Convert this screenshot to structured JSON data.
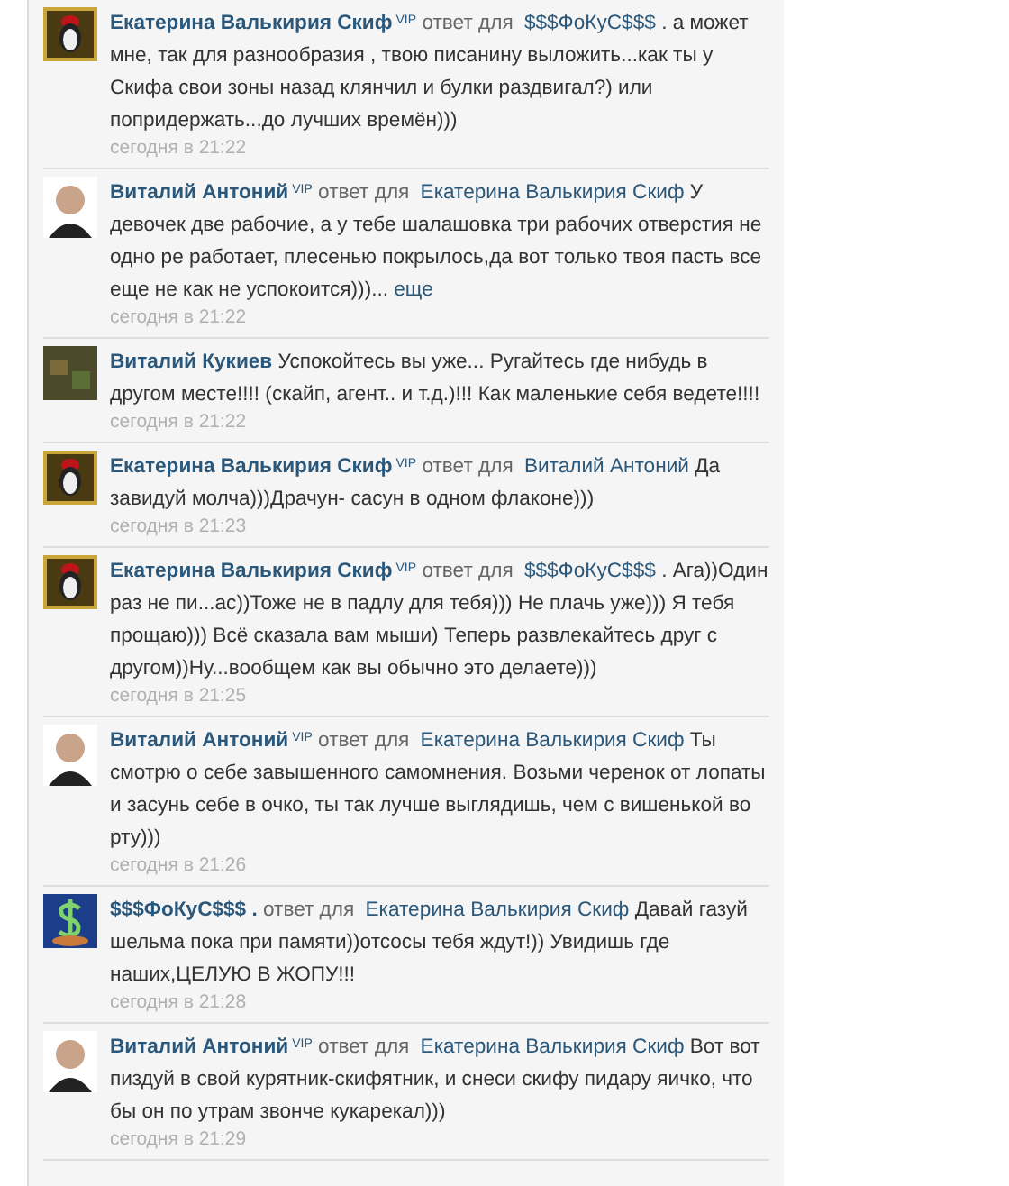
{
  "comments": [
    {
      "kind": "penguin",
      "author": "Екатерина Валькирия Скиф",
      "badge": "VIP",
      "reply_label": "ответ для",
      "reply_to": "$$$ФоКуС$$$",
      "text": ". а может мне, так для разнообразия , твою писанину выложить...как ты у Скифа свои зоны назад клянчил и булки раздвигал?) или попридержать...до лучших времён)))",
      "time": "сегодня в 21:22"
    },
    {
      "kind": "portrait",
      "author": "Виталий Антоний",
      "badge": "VIP",
      "reply_label": "ответ для",
      "reply_to": "Екатерина Валькирия Скиф",
      "text": "У девочек две рабочие, а у тебе шалашовка три рабочих отверстия не одно ре работает, плесенью покрылось,да вот только твоя пасть все еще не как не успокоится)))...",
      "more": "еще",
      "time": "сегодня в 21:22"
    },
    {
      "kind": "game",
      "author": "Виталий Кукиев",
      "text": "Успокойтесь вы уже... Ругайтесь где нибудь в другом месте!!!! (скайп, агент.. и т.д.)!!! Как маленькие себя ведете!!!!",
      "time": "сегодня в 21:22"
    },
    {
      "kind": "penguin",
      "author": "Екатерина Валькирия Скиф",
      "badge": "VIP",
      "reply_label": "ответ для",
      "reply_to": "Виталий Антоний",
      "text": "Да завидуй молча)))Драчун- сасун в одном флаконе)))",
      "time": "сегодня в 21:23"
    },
    {
      "kind": "penguin",
      "author": "Екатерина Валькирия Скиф",
      "badge": "VIP",
      "reply_label": "ответ для",
      "reply_to": "$$$ФоКуС$$$",
      "text": ". Ага))Один раз не пи...ас))Тоже не в падлу для тебя))) Не плачь уже))) Я тебя прощаю))) Всё сказала вам мыши) Теперь развлекайтесь друг с другом))Ну...вообщем как вы обычно это делаете)))",
      "time": "сегодня в 21:25"
    },
    {
      "kind": "portrait",
      "author": "Виталий Антоний",
      "badge": "VIP",
      "reply_label": "ответ для",
      "reply_to": "Екатерина Валькирия Скиф",
      "text": "Ты смотрю о себе завышенного самомнения. Возьми черенок от лопаты и засунь себе в очко, ты так лучше выглядишь, чем с вишенькой во рту)))",
      "time": "сегодня в 21:26"
    },
    {
      "kind": "dollar",
      "author": "$$$ФоКуС$$$ .",
      "reply_label": "ответ для",
      "reply_to": "Екатерина Валькирия Скиф",
      "text": "Давай газуй шельма пока при памяти))отсосы тебя ждут!)) Увидишь где наших,ЦЕЛУЮ В ЖОПУ!!!",
      "time": "сегодня в 21:28"
    },
    {
      "kind": "portrait",
      "author": "Виталий Антоний",
      "badge": "VIP",
      "reply_label": "ответ для",
      "reply_to": "Екатерина Валькирия Скиф",
      "text": "Вот вот пиздуй в свой курятник-скифятник, и снеси скифу пидару яичко, что бы он по утрам звонче кукарекал)))",
      "time": "сегодня в 21:29"
    }
  ]
}
